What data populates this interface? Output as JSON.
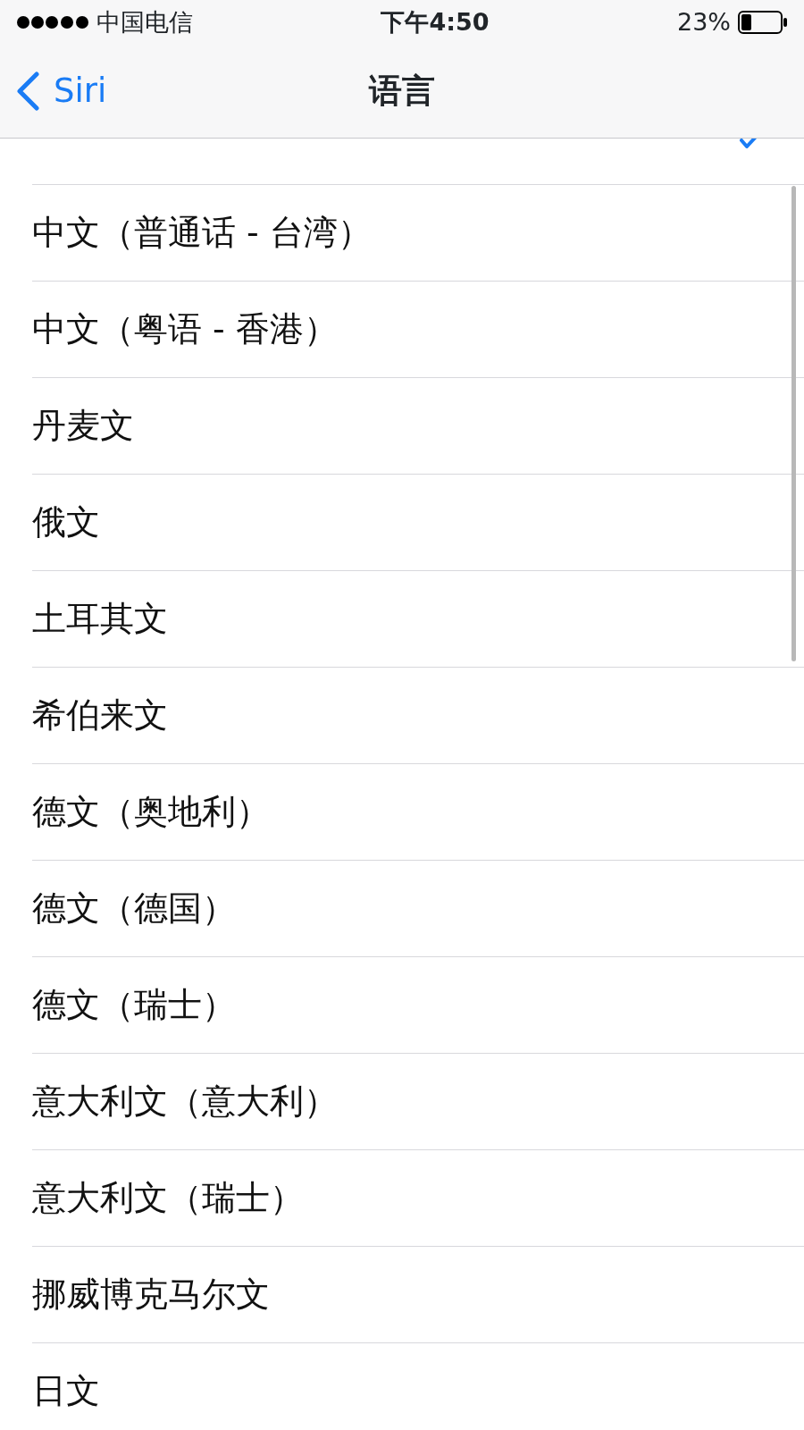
{
  "status_bar": {
    "carrier": "中国电信",
    "time": "下午4:50",
    "battery": "23%"
  },
  "nav": {
    "back": "Siri",
    "title": "语言"
  },
  "languages": [
    {
      "selected": true
    },
    {
      "name": "中文（普通话 - 台湾）",
      "selected": false
    },
    {
      "name": "中文（粤语 - 香港）",
      "selected": false
    },
    {
      "name": "丹麦文",
      "selected": false
    },
    {
      "name": "俄文",
      "selected": false
    },
    {
      "name": "土耳其文",
      "selected": false
    },
    {
      "name": "希伯来文",
      "selected": false
    },
    {
      "name": "德文（奥地利）",
      "selected": false
    },
    {
      "name": "德文（德国）",
      "selected": false
    },
    {
      "name": "德文（瑞士）",
      "selected": false
    },
    {
      "name": "意大利文（意大利）",
      "selected": false
    },
    {
      "name": "意大利文（瑞士）",
      "selected": false
    },
    {
      "name": "挪威博克马尔文",
      "selected": false
    },
    {
      "name": "日文",
      "selected": false
    }
  ]
}
